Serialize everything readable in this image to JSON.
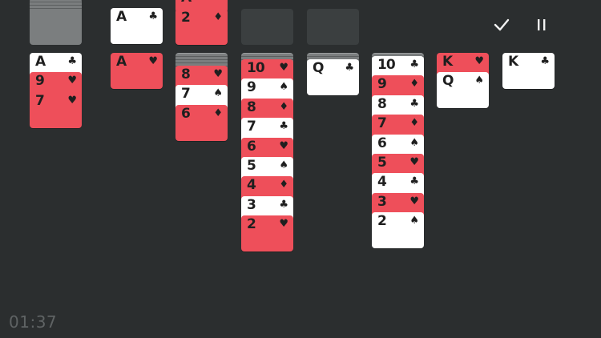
{
  "timer": "01:37",
  "controls": {
    "confirm_icon": "check-icon",
    "pause_icon": "pause-icon"
  },
  "colors": {
    "background": "#2b2e2f",
    "red_card": "#ee4f5a",
    "white_card": "#ffffff",
    "card_back": "#7b7e7f",
    "empty_slot": "#3b3f40"
  },
  "stock": {
    "face_down_cards": true
  },
  "waste": {
    "top_card": {
      "rank": "A",
      "suit": "♣",
      "suit_name": "clubs",
      "color": "white"
    }
  },
  "foundations": [
    {
      "cards": [
        {
          "rank": "A",
          "suit": "♦",
          "suit_name": "diamonds",
          "color": "red"
        },
        {
          "rank": "2",
          "suit": "♦",
          "suit_name": "diamonds",
          "color": "red"
        }
      ]
    },
    {
      "cards": []
    },
    {
      "cards": []
    }
  ],
  "tableau": [
    {
      "hidden": 0,
      "cards": [
        {
          "rank": "A",
          "suit": "♣",
          "color": "white"
        },
        {
          "rank": "9",
          "suit": "♥",
          "color": "red"
        },
        {
          "rank": "7",
          "suit": "♥",
          "color": "red"
        }
      ]
    },
    {
      "hidden": 0,
      "cards": [
        {
          "rank": "A",
          "suit": "♥",
          "color": "red"
        }
      ]
    },
    {
      "hidden": 4,
      "cards": [
        {
          "rank": "8",
          "suit": "♥",
          "color": "red"
        },
        {
          "rank": "7",
          "suit": "♠",
          "color": "white"
        },
        {
          "rank": "6",
          "suit": "♦",
          "color": "red"
        }
      ]
    },
    {
      "hidden": 2,
      "cards": [
        {
          "rank": "10",
          "suit": "♥",
          "color": "red"
        },
        {
          "rank": "9",
          "suit": "♠",
          "color": "white"
        },
        {
          "rank": "8",
          "suit": "♦",
          "color": "red"
        },
        {
          "rank": "7",
          "suit": "♣",
          "color": "white"
        },
        {
          "rank": "6",
          "suit": "♥",
          "color": "red"
        },
        {
          "rank": "5",
          "suit": "♠",
          "color": "white"
        },
        {
          "rank": "4",
          "suit": "♦",
          "color": "red"
        },
        {
          "rank": "3",
          "suit": "♣",
          "color": "white"
        },
        {
          "rank": "2",
          "suit": "♥",
          "color": "red"
        }
      ]
    },
    {
      "hidden": 2,
      "cards": [
        {
          "rank": "Q",
          "suit": "♣",
          "color": "white"
        }
      ]
    },
    {
      "hidden": 1,
      "cards": [
        {
          "rank": "10",
          "suit": "♣",
          "color": "white"
        },
        {
          "rank": "9",
          "suit": "♦",
          "color": "red"
        },
        {
          "rank": "8",
          "suit": "♣",
          "color": "white"
        },
        {
          "rank": "7",
          "suit": "♦",
          "color": "red"
        },
        {
          "rank": "6",
          "suit": "♠",
          "color": "white"
        },
        {
          "rank": "5",
          "suit": "♥",
          "color": "red"
        },
        {
          "rank": "4",
          "suit": "♣",
          "color": "white"
        },
        {
          "rank": "3",
          "suit": "♥",
          "color": "red"
        },
        {
          "rank": "2",
          "suit": "♠",
          "color": "white"
        }
      ]
    },
    {
      "hidden": 0,
      "cards": [
        {
          "rank": "K",
          "suit": "♥",
          "color": "red"
        },
        {
          "rank": "Q",
          "suit": "♠",
          "color": "white"
        }
      ]
    },
    {
      "hidden": 0,
      "cards": [
        {
          "rank": "K",
          "suit": "♣",
          "color": "white"
        }
      ]
    }
  ]
}
